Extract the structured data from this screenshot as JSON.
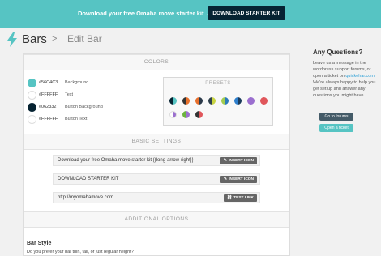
{
  "banner": {
    "text": "Download your free Omaha move starter kit →",
    "button": "DOWNLOAD STARTER KIT"
  },
  "header": {
    "title": "Bars",
    "separator": ">",
    "subtitle": "Edit Bar"
  },
  "colors": {
    "section_label": "COLORS",
    "items": [
      {
        "hex": "#56C4C3",
        "label": "Background",
        "swatch": "#56C4C3"
      },
      {
        "hex": "#FFFFFF",
        "label": "Text",
        "swatch": "#FFFFFF"
      },
      {
        "hex": "#062332",
        "label": "Button Background",
        "swatch": "#062332"
      },
      {
        "hex": "#FFFFFF",
        "label": "Button Text",
        "swatch": "#FFFFFF"
      }
    ],
    "presets_label": "PRESETS"
  },
  "basic": {
    "section_label": "BASIC SETTINGS",
    "rows": [
      {
        "value": "Download your free Omaha move starter kit {{long-arrow-right}}",
        "button": "INSERT ICON",
        "icon": "pencil-icon"
      },
      {
        "value": "DOWNLOAD STARTER KIT",
        "button": "INSERT ICON",
        "icon": "pencil-icon"
      },
      {
        "value": "http://myomahamove.com",
        "button": "TEST LINK",
        "icon": "link-icon"
      }
    ]
  },
  "additional": {
    "section_label": "ADDITIONAL OPTIONS",
    "bar_style_title": "Bar Style",
    "bar_style_question": "Do you prefer your bar thin, tall, or just regular height?"
  },
  "sidebar": {
    "title": "Any Questions?",
    "text_before": "Leave us a message in the wordpress support forums, or open a ticket on ",
    "link": "quickehar.com",
    "text_after": ". We're always happy to help you get set up and answer any questions you might have.",
    "forums_button": "Go to forums",
    "ticket_button": "Open a ticket"
  }
}
